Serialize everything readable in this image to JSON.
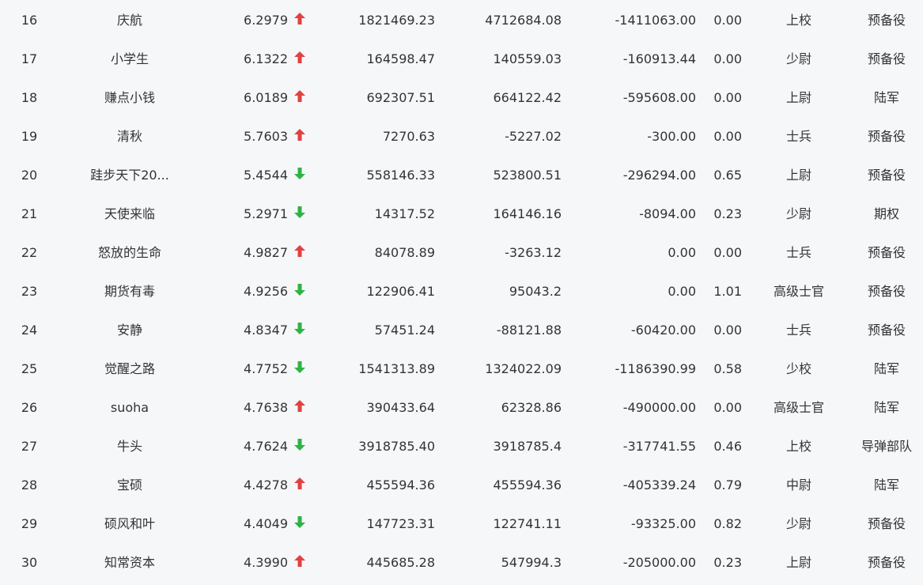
{
  "colors": {
    "up": "#e24141",
    "down": "#2fb344"
  },
  "rows": [
    {
      "rank": "16",
      "name": "庆航",
      "score": "6.2979",
      "trend": "up",
      "v1": "1821469.23",
      "v2": "4712684.08",
      "v3": "-1411063.00",
      "v4": "0.00",
      "title": "上校",
      "branch": "预备役"
    },
    {
      "rank": "17",
      "name": "小学生",
      "score": "6.1322",
      "trend": "up",
      "v1": "164598.47",
      "v2": "140559.03",
      "v3": "-160913.44",
      "v4": "0.00",
      "title": "少尉",
      "branch": "预备役"
    },
    {
      "rank": "18",
      "name": "赚点小钱",
      "score": "6.0189",
      "trend": "up",
      "v1": "692307.51",
      "v2": "664122.42",
      "v3": "-595608.00",
      "v4": "0.00",
      "title": "上尉",
      "branch": "陆军"
    },
    {
      "rank": "19",
      "name": "清秋",
      "score": "5.7603",
      "trend": "up",
      "v1": "7270.63",
      "v2": "-5227.02",
      "v3": "-300.00",
      "v4": "0.00",
      "title": "士兵",
      "branch": "预备役"
    },
    {
      "rank": "20",
      "name": "跬步天下20...",
      "score": "5.4544",
      "trend": "down",
      "v1": "558146.33",
      "v2": "523800.51",
      "v3": "-296294.00",
      "v4": "0.65",
      "title": "上尉",
      "branch": "预备役"
    },
    {
      "rank": "21",
      "name": "天使来临",
      "score": "5.2971",
      "trend": "down",
      "v1": "14317.52",
      "v2": "164146.16",
      "v3": "-8094.00",
      "v4": "0.23",
      "title": "少尉",
      "branch": "期权"
    },
    {
      "rank": "22",
      "name": "怒放的生命",
      "score": "4.9827",
      "trend": "up",
      "v1": "84078.89",
      "v2": "-3263.12",
      "v3": "0.00",
      "v4": "0.00",
      "title": "士兵",
      "branch": "预备役"
    },
    {
      "rank": "23",
      "name": "期货有毒",
      "score": "4.9256",
      "trend": "down",
      "v1": "122906.41",
      "v2": "95043.2",
      "v3": "0.00",
      "v4": "1.01",
      "title": "高级士官",
      "branch": "预备役"
    },
    {
      "rank": "24",
      "name": "安静",
      "score": "4.8347",
      "trend": "down",
      "v1": "57451.24",
      "v2": "-88121.88",
      "v3": "-60420.00",
      "v4": "0.00",
      "title": "士兵",
      "branch": "预备役"
    },
    {
      "rank": "25",
      "name": "觉醒之路",
      "score": "4.7752",
      "trend": "down",
      "v1": "1541313.89",
      "v2": "1324022.09",
      "v3": "-1186390.99",
      "v4": "0.58",
      "title": "少校",
      "branch": "陆军"
    },
    {
      "rank": "26",
      "name": "suoha",
      "score": "4.7638",
      "trend": "up",
      "v1": "390433.64",
      "v2": "62328.86",
      "v3": "-490000.00",
      "v4": "0.00",
      "title": "高级士官",
      "branch": "陆军"
    },
    {
      "rank": "27",
      "name": "牛头",
      "score": "4.7624",
      "trend": "down",
      "v1": "3918785.40",
      "v2": "3918785.4",
      "v3": "-317741.55",
      "v4": "0.46",
      "title": "上校",
      "branch": "导弹部队"
    },
    {
      "rank": "28",
      "name": "宝硕",
      "score": "4.4278",
      "trend": "up",
      "v1": "455594.36",
      "v2": "455594.36",
      "v3": "-405339.24",
      "v4": "0.79",
      "title": "中尉",
      "branch": "陆军"
    },
    {
      "rank": "29",
      "name": "硕风和叶",
      "score": "4.4049",
      "trend": "down",
      "v1": "147723.31",
      "v2": "122741.11",
      "v3": "-93325.00",
      "v4": "0.82",
      "title": "少尉",
      "branch": "预备役"
    },
    {
      "rank": "30",
      "name": "知常资本",
      "score": "4.3990",
      "trend": "up",
      "v1": "445685.28",
      "v2": "547994.3",
      "v3": "-205000.00",
      "v4": "0.23",
      "title": "上尉",
      "branch": "预备役"
    }
  ]
}
